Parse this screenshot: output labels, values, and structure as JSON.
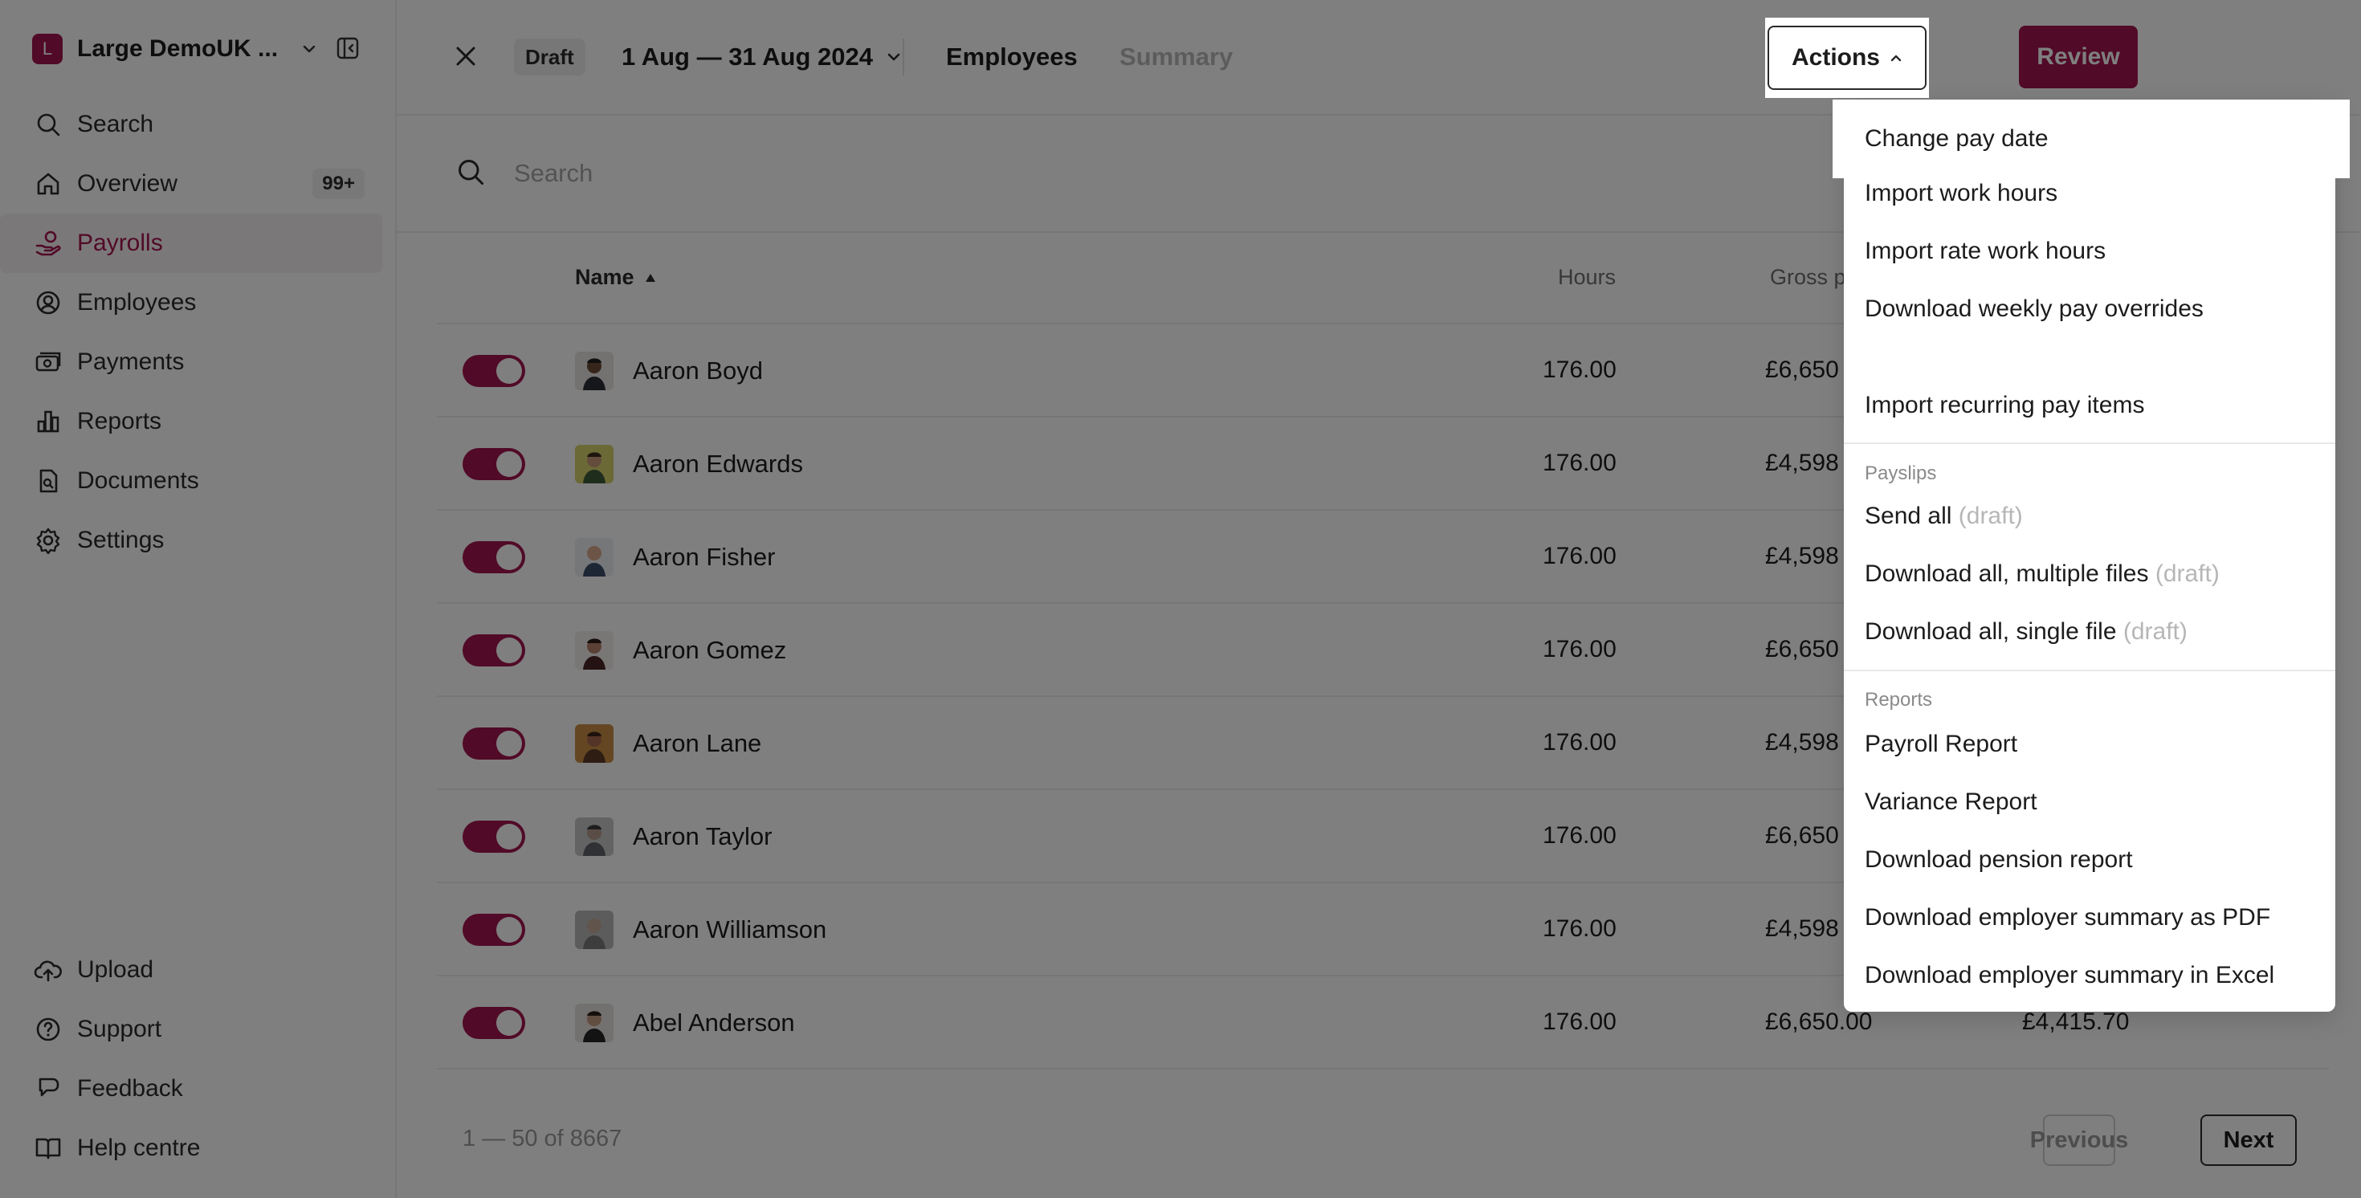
{
  "sidebar": {
    "org_initial": "L",
    "org_name": "Large DemoUK ...",
    "items": [
      {
        "label": "Search",
        "icon": "search-icon"
      },
      {
        "label": "Overview",
        "icon": "home-icon",
        "badge": "99+"
      },
      {
        "label": "Payrolls",
        "icon": "payroll-hand-icon",
        "active": true
      },
      {
        "label": "Employees",
        "icon": "person-circle-icon"
      },
      {
        "label": "Payments",
        "icon": "payments-icon"
      },
      {
        "label": "Reports",
        "icon": "bar-chart-icon"
      },
      {
        "label": "Documents",
        "icon": "document-icon"
      },
      {
        "label": "Settings",
        "icon": "gear-icon"
      }
    ],
    "bottom_items": [
      {
        "label": "Upload",
        "icon": "cloud-upload-icon"
      },
      {
        "label": "Support",
        "icon": "question-circle-icon"
      },
      {
        "label": "Feedback",
        "icon": "feedback-icon"
      },
      {
        "label": "Help centre",
        "icon": "book-icon"
      }
    ]
  },
  "header": {
    "status": "Draft",
    "period": "1 Aug — 31 Aug 2024",
    "tabs": [
      {
        "label": "Employees",
        "active": true
      },
      {
        "label": "Summary",
        "active": false
      }
    ],
    "review_label": "Review",
    "actions_label": "Actions"
  },
  "search": {
    "placeholder": "Search",
    "value": ""
  },
  "table": {
    "columns": {
      "name": "Name",
      "hours": "Hours",
      "gross": "Gross p"
    },
    "rows": [
      {
        "name": "Aaron Boyd",
        "hours": "176.00",
        "gross": "£6,650",
        "net": "",
        "enabled": true
      },
      {
        "name": "Aaron Edwards",
        "hours": "176.00",
        "gross": "£4,598",
        "net": "",
        "enabled": true
      },
      {
        "name": "Aaron Fisher",
        "hours": "176.00",
        "gross": "£4,598",
        "net": "",
        "enabled": true
      },
      {
        "name": "Aaron Gomez",
        "hours": "176.00",
        "gross": "£6,650",
        "net": "",
        "enabled": true
      },
      {
        "name": "Aaron Lane",
        "hours": "176.00",
        "gross": "£4,598",
        "net": "",
        "enabled": true
      },
      {
        "name": "Aaron Taylor",
        "hours": "176.00",
        "gross": "£6,650",
        "net": "",
        "enabled": true
      },
      {
        "name": "Aaron Williamson",
        "hours": "176.00",
        "gross": "£4,598",
        "net": "",
        "enabled": true
      },
      {
        "name": "Abel Anderson",
        "hours": "176.00",
        "gross": "£6,650.00",
        "net": "£4,415.70",
        "enabled": true
      }
    ]
  },
  "pagination": {
    "range": "1 — 50 of 8667",
    "previous": "Previous",
    "next": "Next"
  },
  "actions_menu": {
    "highlighted": "Change pay date",
    "items_top": [
      "Import work hours",
      "Import rate work hours",
      "Download weekly pay overrides",
      "Import recurring pay items"
    ],
    "payslips_header": "Payslips",
    "payslips": [
      {
        "label": "Send all",
        "suffix": "(draft)"
      },
      {
        "label": "Download all, multiple files",
        "suffix": "(draft)"
      },
      {
        "label": "Download all, single file",
        "suffix": "(draft)"
      }
    ],
    "reports_header": "Reports",
    "reports": [
      "Payroll Report",
      "Variance Report",
      "Download pension report",
      "Download employer summary as PDF",
      "Download employer summary in Excel"
    ]
  },
  "colors": {
    "brand": "#a3154e"
  }
}
